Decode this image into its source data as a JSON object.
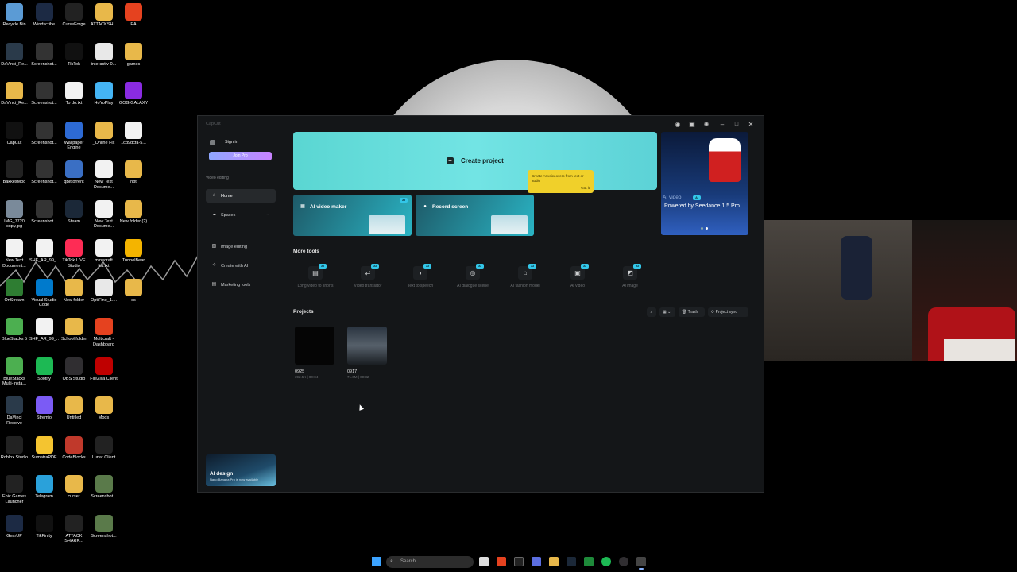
{
  "desktop": {
    "icons": [
      {
        "label": "Recycle Bin",
        "color": "#5b9bd5"
      },
      {
        "label": "Windscribe",
        "color": "#1c2a44"
      },
      {
        "label": "CurseForge",
        "color": "#222222"
      },
      {
        "label": "ATTACKSH...",
        "color": "#e8b84a"
      },
      {
        "label": "EA",
        "color": "#e5421f"
      },
      {
        "label": "DaVinci_Re...",
        "color": "#2a3a4a"
      },
      {
        "label": "Screenshot...",
        "color": "#333333"
      },
      {
        "label": "TikTok",
        "color": "#111111"
      },
      {
        "label": "interactiv-0...",
        "color": "#e8e8e8"
      },
      {
        "label": "games",
        "color": "#e8b84a"
      },
      {
        "label": "DaVinci_Re...",
        "color": "#e8b84a"
      },
      {
        "label": "Screenshot...",
        "color": "#333333"
      },
      {
        "label": "To do.txt",
        "color": "#f2f2f2"
      },
      {
        "label": "HoYoPlay",
        "color": "#44b4f4"
      },
      {
        "label": "GOG GALAXY",
        "color": "#8a2be2"
      },
      {
        "label": "CapCut",
        "color": "#111111"
      },
      {
        "label": "Screenshot...",
        "color": "#333333"
      },
      {
        "label": "Wallpaper Engine",
        "color": "#2d6ad4"
      },
      {
        "label": "_Online Fix",
        "color": "#e8b84a"
      },
      {
        "label": "1cd9dcfa-5...",
        "color": "#f2f2f2"
      },
      {
        "label": "BakkesMod",
        "color": "#222222"
      },
      {
        "label": "Screenshot...",
        "color": "#333333"
      },
      {
        "label": "qBittorrent",
        "color": "#3a6fc4"
      },
      {
        "label": "New Text Docume...",
        "color": "#f2f2f2"
      },
      {
        "label": "nbt",
        "color": "#e8b84a"
      },
      {
        "label": "IMG_7720 copy.jpg",
        "color": "#7a8a9a"
      },
      {
        "label": "Screenshot...",
        "color": "#333333"
      },
      {
        "label": "Steam",
        "color": "#1b2838"
      },
      {
        "label": "New Text Docume...",
        "color": "#f2f2f2"
      },
      {
        "label": "New folder (2)",
        "color": "#e8b84a"
      },
      {
        "label": "New Text Document...",
        "color": "#f2f2f2"
      },
      {
        "label": "SHF_AR_99_...",
        "color": "#f2f2f2"
      },
      {
        "label": "TikTok LIVE Studio",
        "color": "#fe2c55"
      },
      {
        "label": "minecraft list.txt",
        "color": "#f2f2f2"
      },
      {
        "label": "TunnelBear",
        "color": "#f4b400"
      },
      {
        "label": "OnStream",
        "color": "#2e7d32"
      },
      {
        "label": "Visual Studio Code",
        "color": "#007acc"
      },
      {
        "label": "New folder",
        "color": "#e8b84a"
      },
      {
        "label": "OptiFine_1....",
        "color": "#e8e8e8"
      },
      {
        "label": "ss",
        "color": "#e8b84a"
      },
      {
        "label": "BlueStacks 5",
        "color": "#4caf50"
      },
      {
        "label": "SHF_AR_99_...",
        "color": "#f2f2f2"
      },
      {
        "label": "School folder",
        "color": "#e8b84a"
      },
      {
        "label": "Multicraft - Dashboard",
        "color": "#e5421f"
      },
      {
        "label": "",
        "color": ""
      },
      {
        "label": "BlueStacks Multi-Insta...",
        "color": "#4caf50"
      },
      {
        "label": "Spotify",
        "color": "#1db954"
      },
      {
        "label": "OBS Studio",
        "color": "#302e31"
      },
      {
        "label": "FileZilla Client",
        "color": "#bf0000"
      },
      {
        "label": "",
        "color": ""
      },
      {
        "label": "DaVinci Resolve",
        "color": "#2a3a4a"
      },
      {
        "label": "Stremio",
        "color": "#7b5bf5"
      },
      {
        "label": "Untitled",
        "color": "#e8b84a"
      },
      {
        "label": "Mods",
        "color": "#e8b84a"
      },
      {
        "label": "",
        "color": ""
      },
      {
        "label": "Roblox Studio",
        "color": "#222222"
      },
      {
        "label": "SumatraPDF",
        "color": "#f4c430"
      },
      {
        "label": "CodeBlocks",
        "color": "#c0392b"
      },
      {
        "label": "Lunar Client",
        "color": "#222222"
      },
      {
        "label": "",
        "color": ""
      },
      {
        "label": "Epic Games Launcher",
        "color": "#222222"
      },
      {
        "label": "Telegram",
        "color": "#2aa1da"
      },
      {
        "label": "curser",
        "color": "#e8b84a"
      },
      {
        "label": "Screenshot...",
        "color": "#5a7a4a"
      },
      {
        "label": "",
        "color": ""
      },
      {
        "label": "GearUP",
        "color": "#1c2a44"
      },
      {
        "label": "TikFinity",
        "color": "#111111"
      },
      {
        "label": "ATTACK SHARK...",
        "color": "#222222"
      },
      {
        "label": "Screenshot...",
        "color": "#5a7a4a"
      }
    ]
  },
  "capcut": {
    "app_title": "CapCut",
    "sidebar": {
      "sign_in": "Sign in",
      "join_pro": "Join Pro",
      "section_label": "Video editing",
      "nav_home": "Home",
      "nav_spaces": "Spaces",
      "nav_image": "Image editing",
      "nav_create_ai": "Create with AI",
      "nav_marketing": "Marketing tools",
      "ai_design_title": "AI design",
      "ai_design_sub": "Nano Banana Pro is now available"
    },
    "create_project": "Create project",
    "tooltip": {
      "text": "Create AI voiceovers from text or audio",
      "button": "Got it"
    },
    "tiles": {
      "ai_video_maker": "AI video maker",
      "record_screen": "Record screen",
      "ai_badge": "AI"
    },
    "promo": {
      "badge": "AI video",
      "title": "Powered by Seedance 1.5 Pro"
    },
    "more_tools_title": "More tools",
    "more_tools": [
      {
        "label": "Long video to shorts",
        "icon": "film-icon",
        "glyph": "▤"
      },
      {
        "label": "Video translator",
        "icon": "translate-icon",
        "glyph": "⇄"
      },
      {
        "label": "Text to speech",
        "icon": "speech-icon",
        "glyph": "◖"
      },
      {
        "label": "AI dialogue scene",
        "icon": "dialogue-icon",
        "glyph": "◎"
      },
      {
        "label": "AI fashion model",
        "icon": "shirt-icon",
        "glyph": "⌂"
      },
      {
        "label": "AI video",
        "icon": "video-icon",
        "glyph": "▣"
      },
      {
        "label": "AI image",
        "icon": "image-icon",
        "glyph": "◩"
      }
    ],
    "projects_title": "Projects",
    "project_tools": {
      "trash": "Trash",
      "sync": "Project sync"
    },
    "projects": [
      {
        "name": "0925",
        "meta": "392.5K | 00:04"
      },
      {
        "name": "0917",
        "meta": "71.6M | 00:32"
      }
    ]
  },
  "taskbar": {
    "search_placeholder": "Search"
  },
  "colors": {
    "accent": "#5ad6d2",
    "tooltip": "#f0d02a",
    "join_pro_gradient_start": "#8fa7ff",
    "join_pro_gradient_end": "#c883ff"
  }
}
